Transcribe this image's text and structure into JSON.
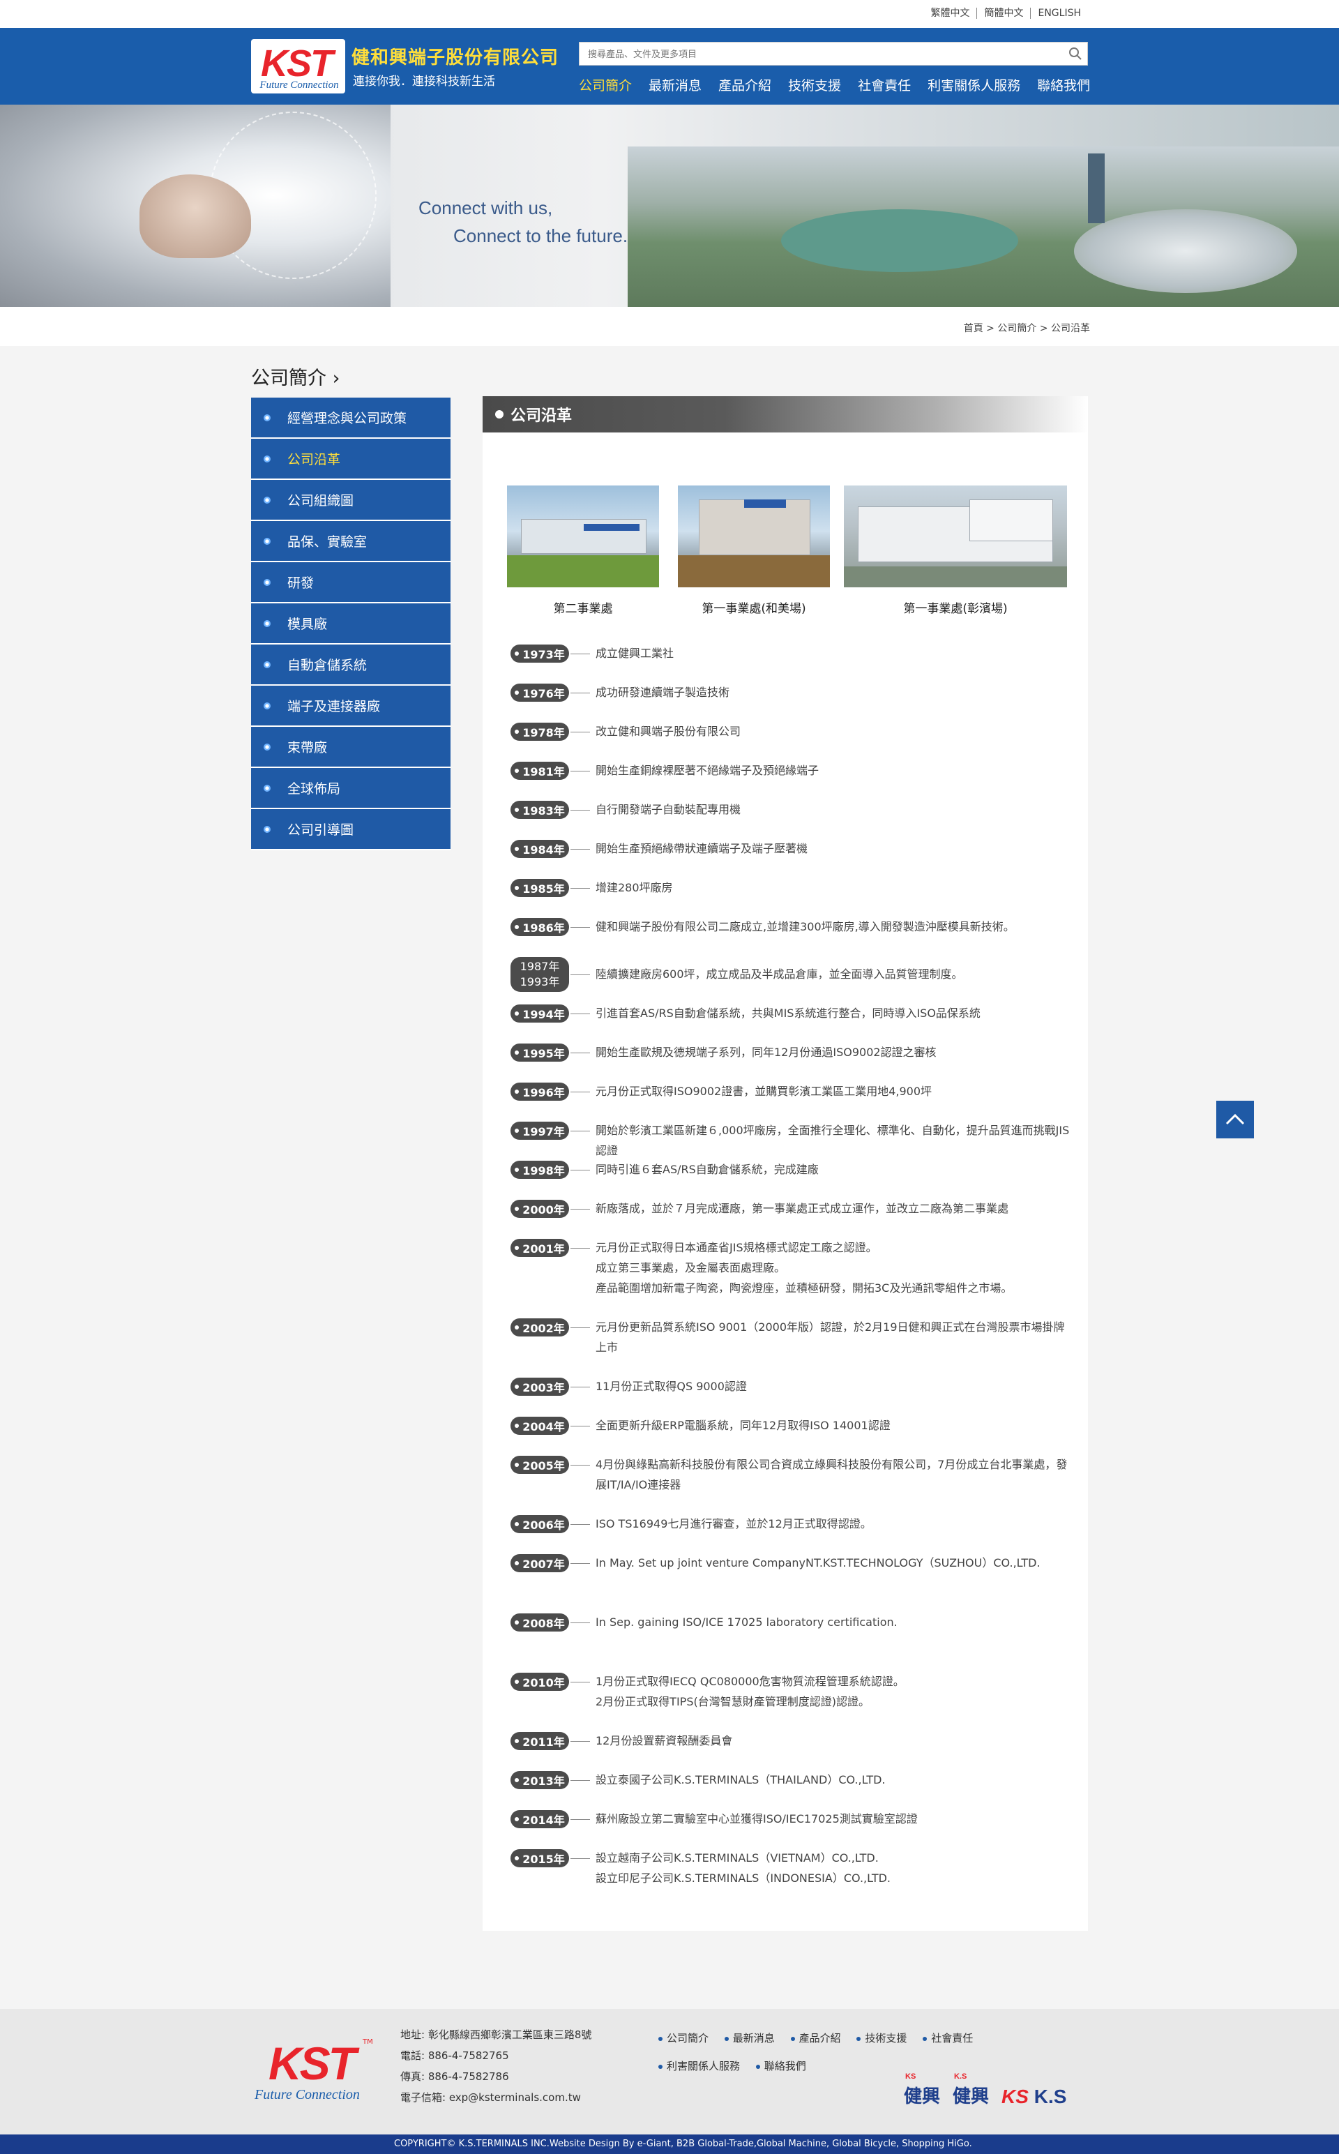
{
  "lang_links": [
    "繁體中文",
    "簡體中文",
    "ENGLISH"
  ],
  "logo": {
    "text": "KST",
    "sub": "Future Connection"
  },
  "company": {
    "name": "健和興端子股份有限公司",
    "slogan": "連接你我．連接科技新生活"
  },
  "search": {
    "placeholder": "搜尋產品、文件及更多項目"
  },
  "nav": [
    "公司簡介",
    "最新消息",
    "產品介紹",
    "技術支援",
    "社會責任",
    "利害關係人服務",
    "聯絡我們"
  ],
  "banner": {
    "line1": "Connect with us,",
    "line2": "Connect to the future."
  },
  "breadcrumb": "首頁 > 公司簡介 > 公司沿革",
  "side_title": "公司簡介 ›",
  "sidebar": [
    "經營理念與公司政策",
    "公司沿革",
    "公司組織圖",
    "品保、實驗室",
    "研發",
    "模具廠",
    "自動倉儲系統",
    "端子及連接器廠",
    "束帶廠",
    "全球佈局",
    "公司引導圖"
  ],
  "panel_title": "公司沿革",
  "photos": [
    "第二事業處",
    "第一事業處(和美場)",
    "第一事業處(彰濱場)"
  ],
  "timeline": [
    {
      "year": "1973年",
      "text": "成立健興工業社"
    },
    {
      "year": "1976年",
      "text": "成功研發連續端子製造技術"
    },
    {
      "year": "1978年",
      "text": "改立健和興端子股份有限公司"
    },
    {
      "year": "1981年",
      "text": "開始生產銅線裸壓著不絕緣端子及預絕緣端子"
    },
    {
      "year": "1983年",
      "text": "自行開發端子自動裝配專用機"
    },
    {
      "year": "1984年",
      "text": "開始生產預絕緣帶狀連續端子及端子壓著機"
    },
    {
      "year": "1985年",
      "text": "增建280坪廠房"
    },
    {
      "year": "1986年",
      "text": "健和興端子股份有限公司二廠成立,並增建300坪廠房,導入開發製造沖壓模具新技術。"
    },
    {
      "year": "1987年",
      "year2": "1993年",
      "text": "陸續擴建廠房600坪，成立成品及半成品倉庫，並全面導入品質管理制度。"
    },
    {
      "year": "1994年",
      "text": "引進首套AS/RS自動倉儲系統，共與MIS系統進行整合，同時導入ISO品保系統"
    },
    {
      "year": "1995年",
      "text": "開始生產歐規及德規端子系列，同年12月份通過ISO9002認證之審核"
    },
    {
      "year": "1996年",
      "text": "元月份正式取得ISO9002證書，並購買彰濱工業區工業用地4,900坪"
    },
    {
      "year": "1997年",
      "text": "開始於彰濱工業區新建６,000坪廠房，全面推行全理化、標準化、自動化，提升品質進而挑戰JIS認證"
    },
    {
      "year": "1998年",
      "text": "同時引進６套AS/RS自動倉儲系統，完成建廠"
    },
    {
      "year": "2000年",
      "text": "新廠落成，並於７月完成遷廠，第一事業處正式成立運作，並改立二廠為第二事業處"
    },
    {
      "year": "2001年",
      "text": "元月份正式取得日本通產省JIS規格標式認定工廠之認證。\n成立第三事業處，及金屬表面處理廠。\n產品範圍增加新電子陶瓷，陶瓷燈座，並積極研發，開拓3C及光通訊零組件之市場。"
    },
    {
      "year": "2002年",
      "text": "元月份更新品質系統ISO 9001（2000年版）認證，於2月19日健和興正式在台灣股票市場掛牌上市"
    },
    {
      "year": "2003年",
      "text": "11月份正式取得QS 9000認證"
    },
    {
      "year": "2004年",
      "text": "全面更新升級ERP電腦系統，同年12月取得ISO 14001認證"
    },
    {
      "year": "2005年",
      "text": "4月份與綠點高新科技股份有限公司合資成立綠興科技股份有限公司，7月份成立台北事業處，發展IT/IA/IO連接器"
    },
    {
      "year": "2006年",
      "text": "ISO TS16949七月進行審查，並於12月正式取得認證。"
    },
    {
      "year": "2007年",
      "text": "In May. Set up joint venture CompanyNT.KST.TECHNOLOGY（SUZHOU）CO.,LTD."
    },
    {
      "year": "2008年",
      "text": "In Sep. gaining ISO/ICE 17025 laboratory certification."
    },
    {
      "year": "2010年",
      "text": "1月份正式取得IECQ QC080000危害物質流程管理系統認證。\n2月份正式取得TIPS(台灣智慧財產管理制度認證)認證。"
    },
    {
      "year": "2011年",
      "text": "12月份設置薪資報酬委員會"
    },
    {
      "year": "2013年",
      "text": "設立泰國子公司K.S.TERMINALS（THAILAND）CO.,LTD."
    },
    {
      "year": "2014年",
      "text": "蘇州廠設立第二實驗室中心並獲得ISO/IEC17025測試實驗室認證"
    },
    {
      "year": "2015年",
      "text": "設立越南子公司K.S.TERMINALS（VIETNAM）CO.,LTD.\n設立印尼子公司K.S.TERMINALS（INDONESIA）CO.,LTD."
    }
  ],
  "footer": {
    "logo_text": "KST",
    "logo_tm": "TM",
    "logo_sub": "Future Connection",
    "address": "地址: 彰化縣線西鄉彰濱工業區東三路8號",
    "phone": "電話: 886-4-7582765",
    "fax": "傳真: 886-4-7582786",
    "email": "電子信箱: exp@ksterminals.com.tw",
    "nav": [
      "公司簡介",
      "最新消息",
      "產品介紹",
      "技術支援",
      "社會責任",
      "利害關係人服務",
      "聯絡我們"
    ],
    "brand1_mini": "KS",
    "brand1": "健興",
    "brand2_mini": "K.S",
    "brand2": "健興",
    "brand3": "K.S",
    "copyright": "COPYRIGHT© K.S.TERMINALS INC.Website Design By e-Giant, B2B Global-Trade,Global Machine, Global Bicycle, Shopping HiGo."
  },
  "colors": {
    "primary": "#1a5dab",
    "accent": "#ffde3b",
    "logo_red": "#e8242b",
    "badge": "#4b4b4b"
  }
}
